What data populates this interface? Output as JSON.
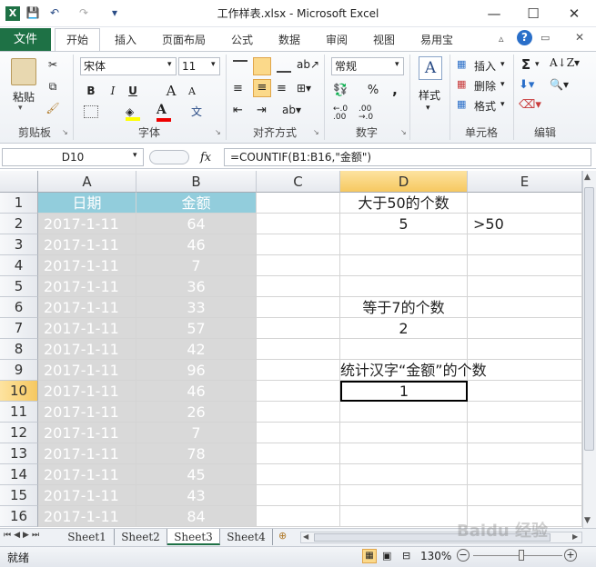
{
  "window": {
    "title": "工作样表.xlsx - Microsoft Excel"
  },
  "quick_access": {
    "save": "💾",
    "undo": "↶",
    "redo": "↷",
    "customize": "▾"
  },
  "tabs": [
    "文件",
    "开始",
    "插入",
    "页面布局",
    "公式",
    "数据",
    "审阅",
    "视图",
    "易用宝"
  ],
  "ribbon": {
    "clipboard": {
      "paste": "粘贴",
      "label": "剪贴板"
    },
    "font": {
      "name": "宋体",
      "size": "11",
      "bold": "B",
      "italic": "I",
      "underline": "U",
      "grow": "A",
      "shrink": "A",
      "label": "字体"
    },
    "alignment": {
      "label": "对齐方式"
    },
    "number": {
      "format": "常规",
      "percent": "%",
      "comma": ",",
      "label": "数字"
    },
    "styles": {
      "label": "样式"
    },
    "cells": {
      "insert": "插入",
      "delete": "删除",
      "format": "格式",
      "label": "单元格"
    },
    "editing": {
      "sum": "Σ",
      "label": "编辑"
    }
  },
  "formula_bar": {
    "name_box": "D10",
    "fx": "fx",
    "formula": "=COUNTIF(B1:B16,\"金额\")"
  },
  "columns": [
    "A",
    "B",
    "C",
    "D",
    "E"
  ],
  "rows": [
    "1",
    "2",
    "3",
    "4",
    "5",
    "6",
    "7",
    "8",
    "9",
    "10",
    "11",
    "12",
    "13",
    "14",
    "15",
    "16"
  ],
  "table": {
    "header": {
      "date": "日期",
      "amount": "金额"
    },
    "records": [
      {
        "date": "2017-1-11",
        "amount": "64"
      },
      {
        "date": "2017-1-11",
        "amount": "46"
      },
      {
        "date": "2017-1-11",
        "amount": "7"
      },
      {
        "date": "2017-1-11",
        "amount": "36"
      },
      {
        "date": "2017-1-11",
        "amount": "33"
      },
      {
        "date": "2017-1-11",
        "amount": "57"
      },
      {
        "date": "2017-1-11",
        "amount": "42"
      },
      {
        "date": "2017-1-11",
        "amount": "96"
      },
      {
        "date": "2017-1-11",
        "amount": "46"
      },
      {
        "date": "2017-1-11",
        "amount": "26"
      },
      {
        "date": "2017-1-11",
        "amount": "7"
      },
      {
        "date": "2017-1-11",
        "amount": "78"
      },
      {
        "date": "2017-1-11",
        "amount": "45"
      },
      {
        "date": "2017-1-11",
        "amount": "43"
      },
      {
        "date": "2017-1-11",
        "amount": "84"
      }
    ]
  },
  "results": {
    "d1": "大于50的个数",
    "d2": "5",
    "e2": ">50",
    "d6": "等于7的个数",
    "d7": "2",
    "d9": "统计汉字“金额”的个数",
    "d10": "1"
  },
  "sheets": [
    "Sheet1",
    "Sheet2",
    "Sheet3",
    "Sheet4"
  ],
  "active_sheet": "Sheet3",
  "status": {
    "ready": "就绪",
    "zoom": "130%"
  },
  "watermark": "Baidu 经验"
}
